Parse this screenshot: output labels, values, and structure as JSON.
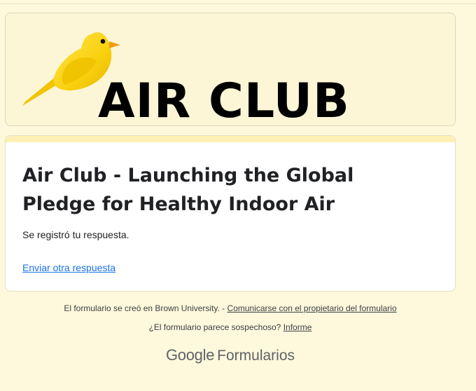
{
  "banner": {
    "title": "AIR CLUB",
    "bird_icon": "canary-bird-icon"
  },
  "form": {
    "title": "Air Club - Launching the Global Pledge for Healthy Indoor Air",
    "confirmation": "Se registró tu respuesta.",
    "another_response_link": "Enviar otra respuesta"
  },
  "footer": {
    "created_in_text": "El formulario se creó en Brown University. -",
    "contact_owner_link": "Comunicarse con el propietario del formulario",
    "suspicious_text": "¿El formulario parece sospechoso?",
    "report_link": "Informe",
    "logo_google": "Google",
    "logo_forms": "Formularios"
  },
  "colors": {
    "page_background": "#fef8dc",
    "accent_strip": "#fdf0b4",
    "link_blue": "#1a73e8",
    "bird_yellow": "#f9d10f"
  }
}
